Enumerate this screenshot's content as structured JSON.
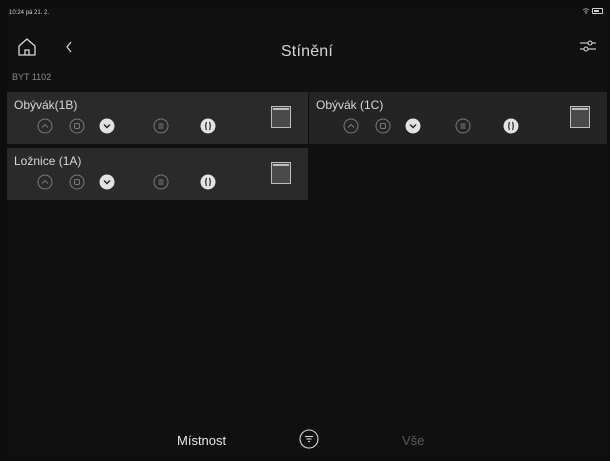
{
  "status": {
    "time": "10:24",
    "date": "pá 21. 2."
  },
  "nav": {
    "title": "Stínění",
    "home_icon": "home-icon",
    "back_icon": "chevron-left-icon",
    "settings_icon": "sliders-icon"
  },
  "section": {
    "label": "BYT 1102"
  },
  "rooms": [
    {
      "name": "Obývák(1B)"
    },
    {
      "name": "Obývák (1C)"
    },
    {
      "name": "Ložnice (1A)"
    }
  ],
  "tabs": {
    "room": "Místnost",
    "all": "Vše"
  },
  "colors": {
    "background": "#101010",
    "card": "#2a2a2a",
    "text": "#d8d8d8",
    "muted": "#5c5c5c"
  }
}
